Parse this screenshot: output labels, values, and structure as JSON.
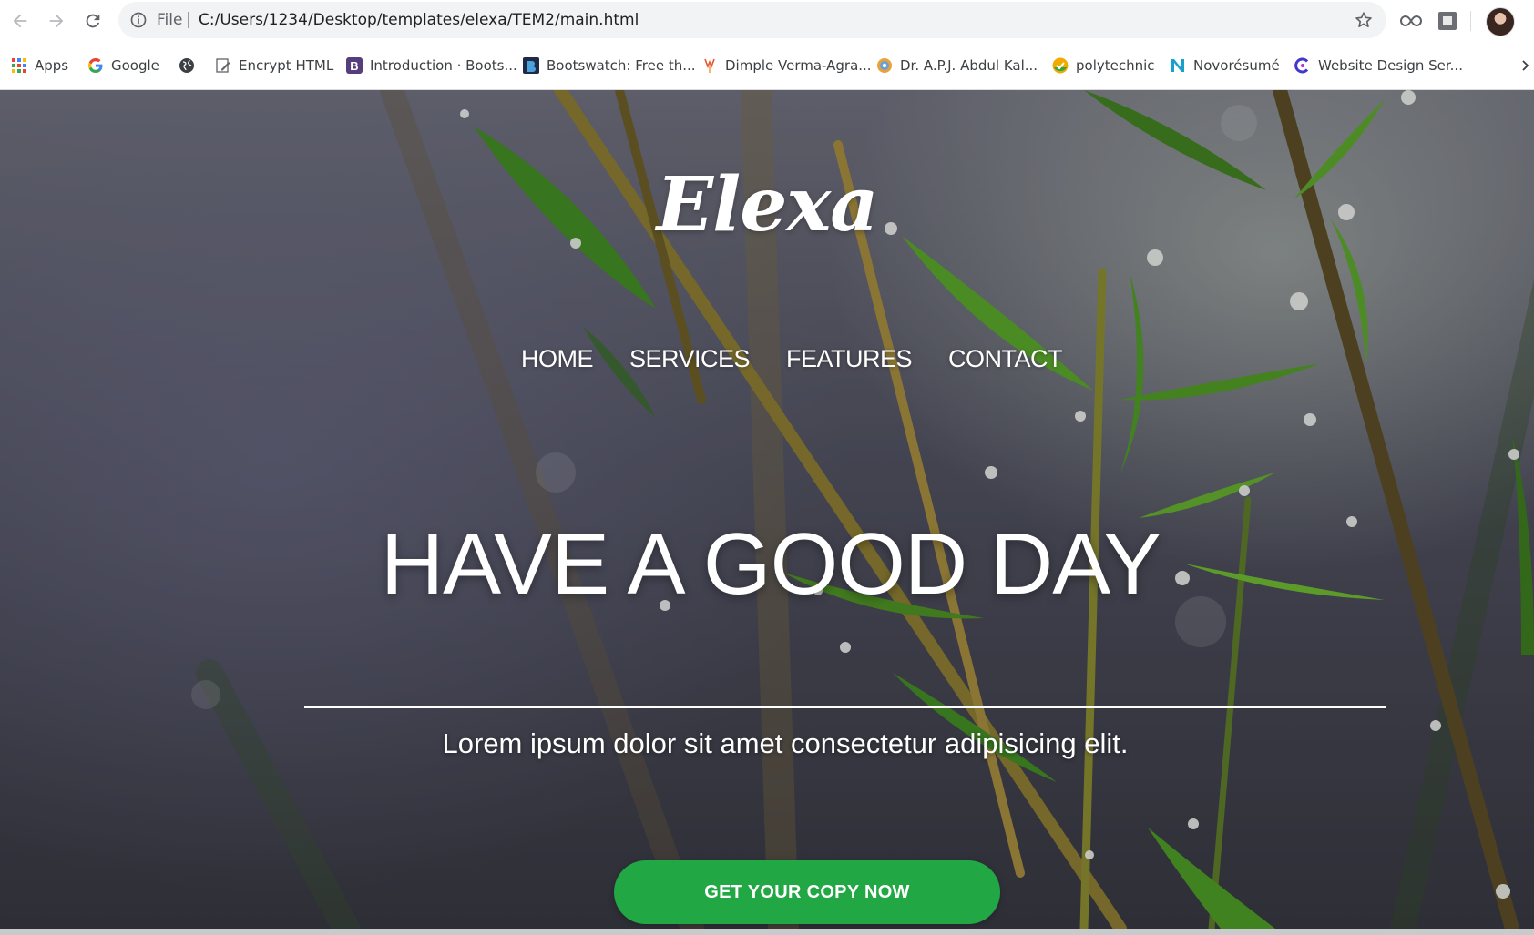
{
  "browser": {
    "omnibox": {
      "scheme_label": "File",
      "url": "C:/Users/1234/Desktop/templates/elexa/TEM2/main.html"
    },
    "bookmarks": [
      {
        "label": "Apps",
        "icon": "apps-grid-icon"
      },
      {
        "label": "Google",
        "icon": "google-icon"
      },
      {
        "label": "",
        "icon": "globe-icon"
      },
      {
        "label": "Encrypt HTML",
        "icon": "pencil-page-icon"
      },
      {
        "label": "Introduction · Boots...",
        "icon": "bootstrap-icon"
      },
      {
        "label": "Bootswatch: Free th...",
        "icon": "bootswatch-icon"
      },
      {
        "label": "Dimple Verma-Agra...",
        "icon": "naukri-icon"
      },
      {
        "label": "Dr. A.P.J. Abdul Kal...",
        "icon": "circle-badge-icon"
      },
      {
        "label": "polytechnic",
        "icon": "check-badge-icon"
      },
      {
        "label": "Novorésumé",
        "icon": "n-logo-icon"
      },
      {
        "label": "Website Design Ser...",
        "icon": "c-logo-icon"
      }
    ],
    "accent_colors": {
      "apps": "#4285f4",
      "bootstrap": "#563d7c",
      "cta": "#22a745"
    }
  },
  "page": {
    "logo": "Elexa",
    "nav": [
      "HOME",
      "SERVICES",
      "FEATURES",
      "CONTACT"
    ],
    "headline": "HAVE A GOOD DAY",
    "subheadline": "Lorem ipsum dolor sit amet consectetur adipisicing elit.",
    "cta_label": "GET YOUR COPY NOW"
  }
}
